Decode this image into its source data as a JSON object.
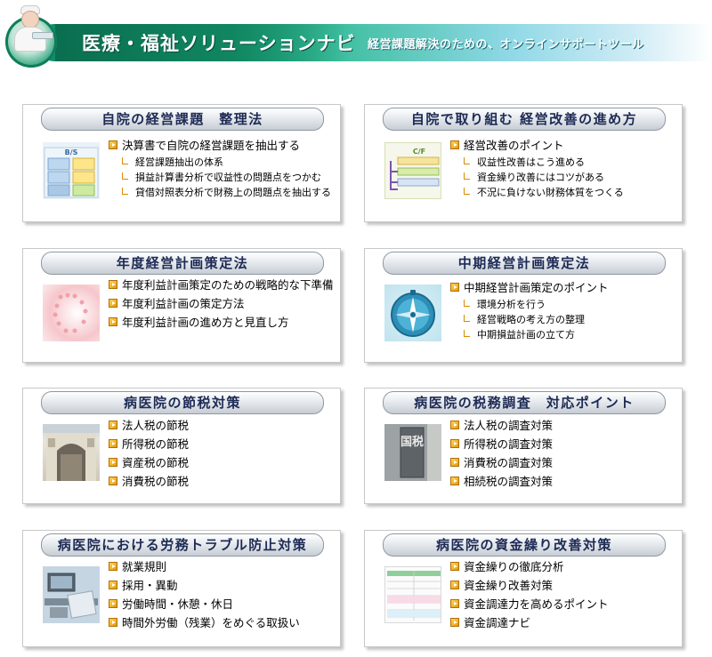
{
  "header": {
    "title": "医療・福祉ソリューションナビ",
    "subtitle": "経営課題解決のための、オンラインサポートツール"
  },
  "cards": [
    {
      "title": "自院の経営課題　整理法",
      "image": "balance-sheet-image",
      "image_label": "B/S",
      "items": [
        {
          "text": "決算書で自院の経営課題を抽出する",
          "subs": [
            "経営課題抽出の体系",
            "損益計算書分析で収益性の問題点をつかむ",
            "貸借対照表分析で財務上の問題点を抽出する"
          ]
        }
      ]
    },
    {
      "title": "自院で取り組む 経営改善の進め方",
      "image": "cash-flow-image",
      "image_label": "C/F",
      "items": [
        {
          "text": "経営改善のポイント",
          "subs": [
            "収益性改善はこう進める",
            "資金繰り改善にはコツがある",
            "不況に負けない財務体質をつくる"
          ]
        }
      ]
    },
    {
      "title": "年度経営計画策定法",
      "image": "pink-dots-image",
      "items": [
        {
          "text": "年度利益計画策定のための戦略的な下準備",
          "subs": []
        },
        {
          "text": "年度利益計画の策定方法",
          "subs": []
        },
        {
          "text": "年度利益計画の進め方と見直し方",
          "subs": []
        }
      ]
    },
    {
      "title": "中期経営計画策定法",
      "image": "compass-image",
      "items": [
        {
          "text": "中期経営計画策定のポイント",
          "subs": [
            "環境分析を行う",
            "経営戦略の考え方の整理",
            "中期損益計画の立て方"
          ]
        }
      ]
    },
    {
      "title": "病医院の節税対策",
      "image": "building-image",
      "items": [
        {
          "text": "法人税の節税",
          "subs": []
        },
        {
          "text": "所得税の節税",
          "subs": []
        },
        {
          "text": "資産税の節税",
          "subs": []
        },
        {
          "text": "消費税の節税",
          "subs": []
        }
      ]
    },
    {
      "title": "病医院の税務調査　対応ポイント",
      "image": "tax-office-image",
      "image_label": "国税",
      "items": [
        {
          "text": "法人税の調査対策",
          "subs": []
        },
        {
          "text": "所得税の調査対策",
          "subs": []
        },
        {
          "text": "消費税の調査対策",
          "subs": []
        },
        {
          "text": "相続税の調査対策",
          "subs": []
        }
      ]
    },
    {
      "title": "病医院における労務トラブル防止対策",
      "image": "office-desk-image",
      "items": [
        {
          "text": "就業規則",
          "subs": []
        },
        {
          "text": "採用・異動",
          "subs": []
        },
        {
          "text": "労働時間・休憩・休日",
          "subs": []
        },
        {
          "text": "時間外労働（残業）をめぐる取扱い",
          "subs": []
        }
      ]
    },
    {
      "title": "病医院の資金繰り改善対策",
      "image": "cash-table-image",
      "items": [
        {
          "text": "資金繰りの徹底分析",
          "subs": []
        },
        {
          "text": "資金繰り改善対策",
          "subs": []
        },
        {
          "text": "資金調達力を高めるポイント",
          "subs": []
        },
        {
          "text": "資金調達ナビ",
          "subs": []
        }
      ]
    }
  ]
}
